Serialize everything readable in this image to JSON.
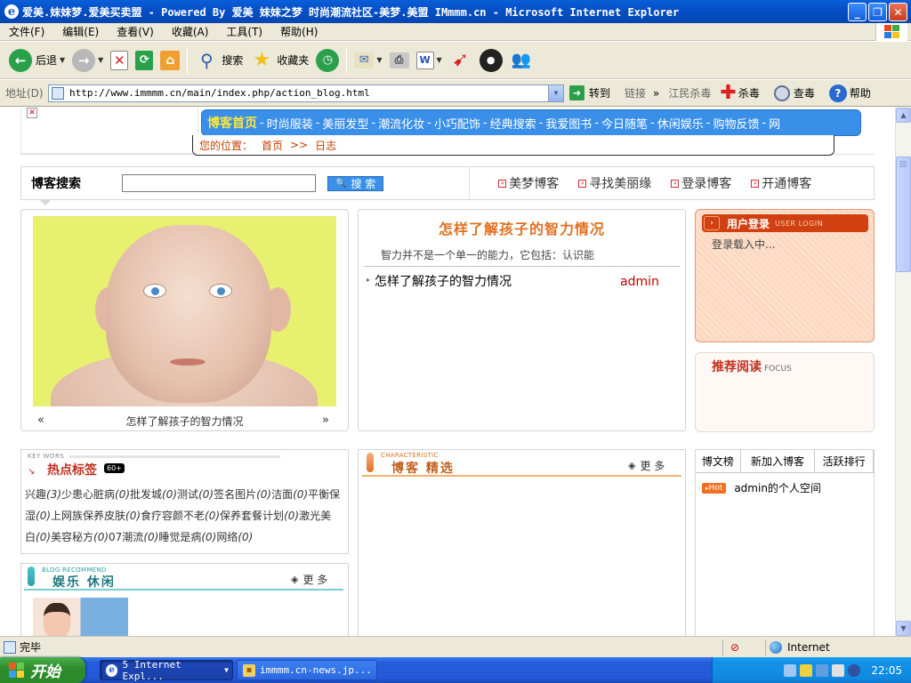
{
  "window": {
    "title": "爱美.妹妹梦.爱美买卖盟 - Powered By 爱美 妹妹之梦 时尚潮流社区-美梦.美盟 IMmmm.cn - Microsoft Internet Explorer"
  },
  "menu": {
    "items": [
      "文件(F)",
      "编辑(E)",
      "查看(V)",
      "收藏(A)",
      "工具(T)",
      "帮助(H)"
    ]
  },
  "toolbar": {
    "back_label": "后退",
    "search_label": "搜索",
    "favorites_label": "收藏夹"
  },
  "addressbar": {
    "label": "地址(D)",
    "url": "http://www.immmm.cn/main/index.php/action_blog.html",
    "go_label": "转到",
    "links_label": "链接",
    "chevron": "»",
    "ext1": "江民杀毒",
    "ext2": "杀毒",
    "ext3": "查毒",
    "ext4": "帮助"
  },
  "page": {
    "nav": {
      "home": "博客首页",
      "items": [
        "时尚服装",
        "美丽发型",
        "潮流化妆",
        "小巧配饰",
        "经典搜索",
        "我爱图书",
        "今日随笔",
        "休闲娱乐",
        "购物反馈",
        "网"
      ],
      "separator": "-"
    },
    "location": {
      "prefix": "您的位置：",
      "home": "首页",
      "sep": ">>",
      "current": "日志"
    },
    "search": {
      "title": "博客搜索",
      "button": "搜 索",
      "links": [
        "美梦博客",
        "寻找美丽缘",
        "登录博客",
        "开通博客"
      ]
    },
    "slideshow": {
      "caption": "怎样了解孩子的智力情况",
      "prev": "«",
      "next": "»"
    },
    "article": {
      "title": "怎样了解孩子的智力情况",
      "summary": "智力并不是一个单一的能力，它包括：认识能",
      "list": [
        {
          "title": "怎样了解孩子的智力情况",
          "author": "admin"
        }
      ]
    },
    "login": {
      "title": "用户登录",
      "subtitle": "USER LOGIN",
      "loading": "登录载入中..."
    },
    "recommend": {
      "title": "推荐阅读",
      "subtitle": "FOCUS"
    },
    "hot_tags": {
      "eyebrow": "KEY WORS",
      "title": "热点标签",
      "badge": "60+",
      "tags": [
        {
          "name": "兴趣",
          "count": "(3)"
        },
        {
          "name": "少患心脏病",
          "count": "(0)"
        },
        {
          "name": "批发城",
          "count": "(0)"
        },
        {
          "name": "测试",
          "count": "(0)"
        },
        {
          "name": "签名图片",
          "count": "(0)"
        },
        {
          "name": "洁面",
          "count": "(0)"
        },
        {
          "name": "平衡保湿",
          "count": "(0)"
        },
        {
          "name": "上网族保养皮肤",
          "count": "(0)"
        },
        {
          "name": "食疗容颜不老",
          "count": "(0)"
        },
        {
          "name": "保养套餐计划",
          "count": "(0)"
        },
        {
          "name": "激光美白",
          "count": "(0)"
        },
        {
          "name": "美容秘方",
          "count": "(0)"
        },
        {
          "name": "07潮流",
          "count": "(0)"
        },
        {
          "name": "睡觉是病",
          "count": "(0)"
        },
        {
          "name": "网络",
          "count": "(0)"
        }
      ]
    },
    "entertainment": {
      "eyebrow": "BLOG RECOMMEND",
      "title": "娱乐 休闲",
      "more": "更 多"
    },
    "featured": {
      "eyebrow": "CHARACTERISTIC",
      "title": "博客 精选",
      "more": "更 多"
    },
    "ranking": {
      "tabs": [
        "博文榜",
        "新加入博客",
        "活跃排行"
      ],
      "items": [
        {
          "badge": "Hot",
          "text": "admin的个人空间"
        }
      ]
    }
  },
  "status": {
    "text": "完毕",
    "zone": "Internet"
  },
  "taskbar": {
    "start": "开始",
    "tasks": [
      "5 Internet Expl...",
      "immmm.cn-news.jp..."
    ],
    "clock": "22:05"
  },
  "colors": {
    "nav_bg": "#3a8fe8",
    "accent_orange": "#e07020",
    "accent_red": "#c03020",
    "teal": "#2aa0a8"
  }
}
